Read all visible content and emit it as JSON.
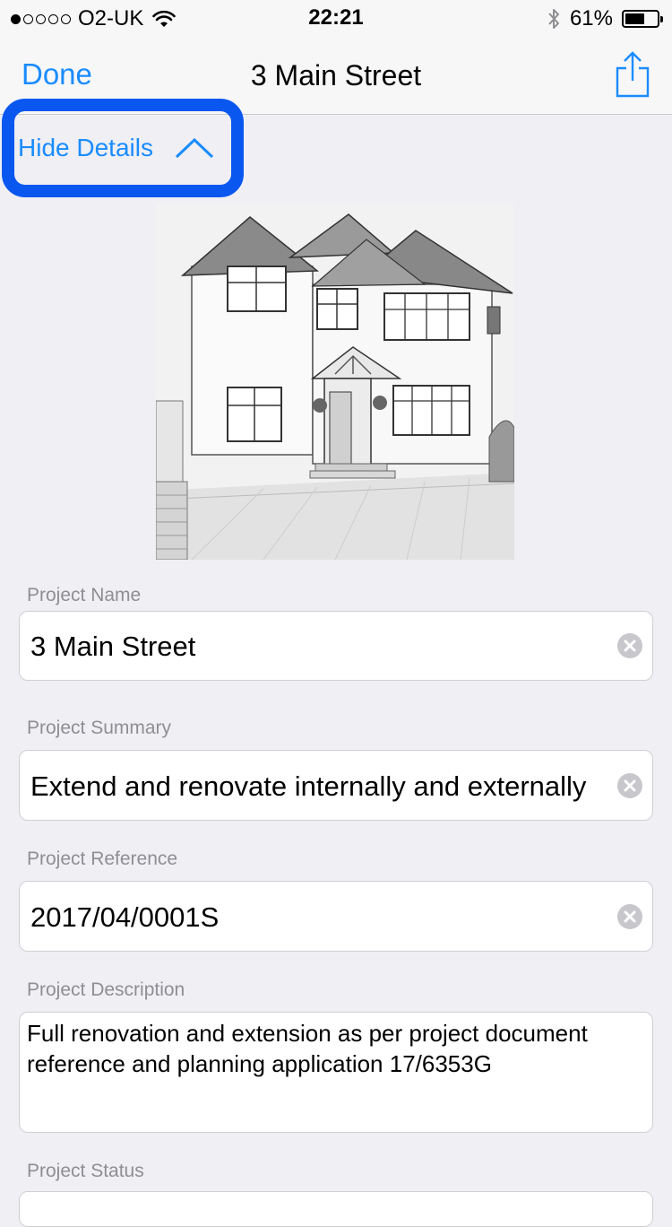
{
  "status_bar": {
    "carrier": "O2-UK",
    "time": "22:21",
    "battery": "61%",
    "battery_level": 0.61,
    "signal_bars_filled": 1,
    "signal_bars_total": 5
  },
  "nav": {
    "done_label": "Done",
    "title": "3 Main Street",
    "share_icon": "share-icon"
  },
  "details_toggle": {
    "label": "Hide Details",
    "icon": "chevron-up-icon"
  },
  "fields": {
    "project_name": {
      "label": "Project Name",
      "value": "3 Main Street"
    },
    "project_summary": {
      "label": "Project Summary",
      "value": "Extend and renovate internally and externally"
    },
    "project_reference": {
      "label": "Project Reference",
      "value": "2017/04/0001S"
    },
    "project_description": {
      "label": "Project Description",
      "value": "Full renovation and extension as per project document reference and planning application 17/6353G"
    },
    "project_status": {
      "label": "Project Status"
    }
  },
  "colors": {
    "accent": "#1a8cff",
    "highlight": "#0a57f0",
    "background": "#efeff4"
  }
}
